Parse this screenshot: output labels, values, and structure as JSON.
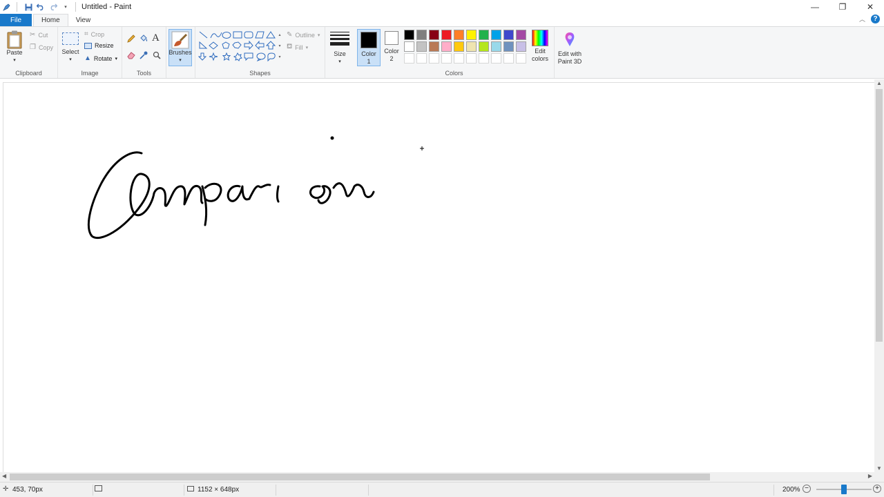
{
  "window": {
    "title": "Untitled - Paint",
    "controls": {
      "minimize": "—",
      "restore": "❐",
      "close": "✕"
    }
  },
  "tabs": {
    "file": "File",
    "home": "Home",
    "view": "View"
  },
  "ribbon": {
    "clipboard": {
      "label": "Clipboard",
      "paste": "Paste",
      "cut": "Cut",
      "copy": "Copy"
    },
    "image": {
      "label": "Image",
      "select": "Select",
      "crop": "Crop",
      "resize": "Resize",
      "rotate": "Rotate"
    },
    "tools": {
      "label": "Tools"
    },
    "brushes": {
      "label": "Brushes"
    },
    "shapes": {
      "label": "Shapes",
      "outline": "Outline",
      "fill": "Fill"
    },
    "size": {
      "label": "Size"
    },
    "colors": {
      "label": "Colors",
      "color1": "Color 1",
      "color2": "Color 2",
      "color1_value": "#000000",
      "color2_value": "#ffffff",
      "edit_colors": "Edit colors",
      "edit_3d": "Edit with Paint 3D",
      "palette_row1": [
        "#000000",
        "#7f7f7f",
        "#880015",
        "#ed1c24",
        "#ff7f27",
        "#fff200",
        "#22b14c",
        "#00a2e8",
        "#3f48cc",
        "#a349a4"
      ],
      "palette_row2": [
        "#ffffff",
        "#c3c3c3",
        "#b97a57",
        "#ffaec9",
        "#ffc90e",
        "#efe4b0",
        "#b5e61d",
        "#99d9ea",
        "#7092be",
        "#c8bfe7"
      ]
    }
  },
  "canvas": {
    "drawing": "Comparison (handwritten)"
  },
  "status": {
    "cursor_pos": "453, 70px",
    "selection_size": "",
    "canvas_size": "1152 × 648px",
    "zoom": "200%"
  }
}
